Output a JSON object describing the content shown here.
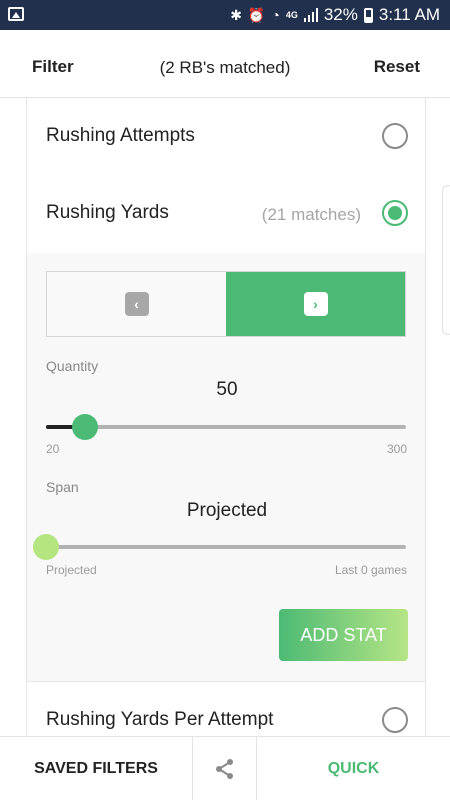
{
  "status_bar": {
    "network": "4G",
    "battery": "32%",
    "time": "3:11 AM"
  },
  "header": {
    "filter_label": "Filter",
    "matched_text": "(2 RB's matched)",
    "reset_label": "Reset"
  },
  "stats": [
    {
      "label": "Rushing Attempts",
      "count": "",
      "selected": false
    },
    {
      "label": "Rushing Yards",
      "count": "(21 matches)",
      "selected": true
    },
    {
      "label": "Rushing Yards Per Attempt",
      "count": "",
      "selected": false
    }
  ],
  "editor": {
    "direction": "greater-than",
    "quantity": {
      "label": "Quantity",
      "value": "50",
      "numeric_value": 50,
      "min": "20",
      "max": "300",
      "min_value": 20,
      "max_value": 300
    },
    "span": {
      "label": "Span",
      "value": "Projected",
      "min_label": "Projected",
      "max_label": "Last 0 games",
      "fraction": 0
    },
    "add_stat_label": "ADD STAT"
  },
  "bottom_bar": {
    "saved_filters_label": "SAVED FILTERS",
    "share_icon": "share-icon",
    "quick_label": "QUICK"
  },
  "colors": {
    "accent": "#4aba74",
    "status_bar": "#21314d"
  }
}
